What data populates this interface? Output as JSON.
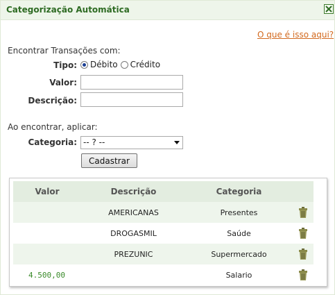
{
  "dialog": {
    "title": "Categorização Automática",
    "close_icon": "close-icon",
    "help_link": "O que é isso aqui?"
  },
  "find": {
    "section_label": "Encontrar Transações com:",
    "type_label": "Tipo:",
    "type_options": [
      {
        "label": "Débito",
        "selected": true
      },
      {
        "label": "Crédito",
        "selected": false
      }
    ],
    "value_label": "Valor:",
    "value_value": "",
    "description_label": "Descrição:",
    "description_value": ""
  },
  "apply": {
    "section_label": "Ao encontrar, aplicar:",
    "category_label": "Categoria:",
    "category_selected": "-- ? --",
    "submit_label": "Cadastrar"
  },
  "rules_table": {
    "columns": [
      "Valor",
      "Descrição",
      "Categoria",
      ""
    ],
    "rows": [
      {
        "valor": "",
        "descricao": "AMERICANAS",
        "categoria": "Presentes",
        "icon": "trash-icon"
      },
      {
        "valor": "",
        "descricao": "DROGASMIL",
        "categoria": "Saúde",
        "icon": "trash-icon"
      },
      {
        "valor": "",
        "descricao": "PREZUNIC",
        "categoria": "Supermercado",
        "icon": "trash-icon"
      },
      {
        "valor": "4.500,00",
        "descricao": "",
        "categoria": "Salario",
        "icon": "trash-icon"
      }
    ]
  },
  "colors": {
    "title_green": "#2e6b23",
    "header_bg": "#e3ede0",
    "alt_row_bg": "#eef5ec",
    "link_orange": "#d2691e",
    "value_green": "#3a8a2a"
  }
}
